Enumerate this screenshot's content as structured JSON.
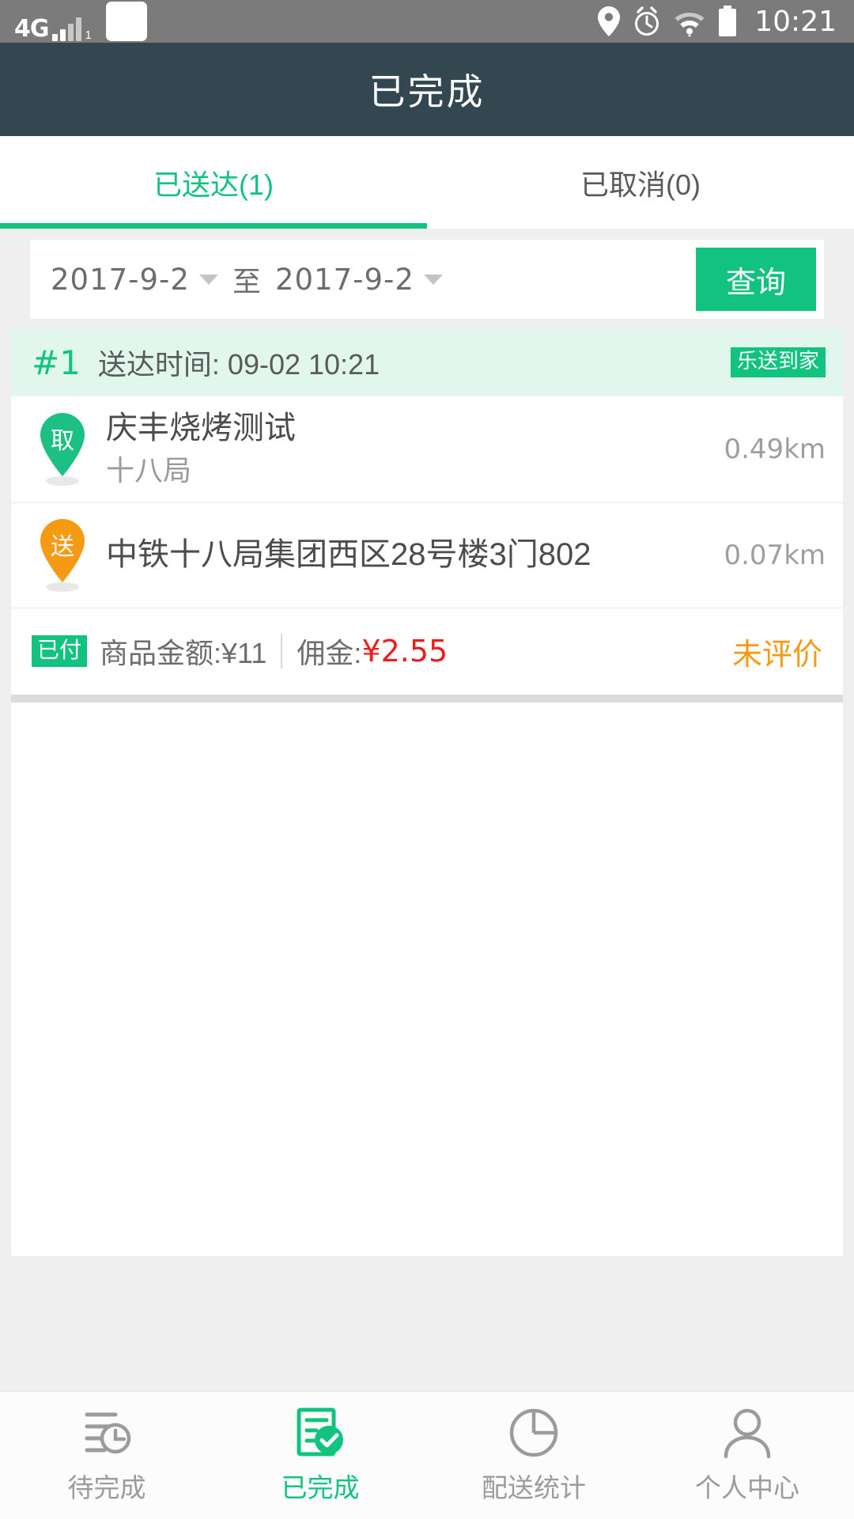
{
  "statusbar": {
    "network": "4G",
    "sim_sub": "1",
    "time": "10:21",
    "icons": [
      "location-icon",
      "alarm-icon",
      "wifi-icon",
      "battery-icon"
    ]
  },
  "header": {
    "title": "已完成"
  },
  "tabs": [
    {
      "label": "已送达(1)",
      "active": true
    },
    {
      "label": "已取消(0)",
      "active": false
    }
  ],
  "query": {
    "start_date": "2017-9-2",
    "to_label": "至",
    "end_date": "2017-9-2",
    "button_label": "查询"
  },
  "orders": [
    {
      "index": "#1",
      "delivered_time": "送达时间: 09-02 10:21",
      "source_badge": "乐送到家",
      "pickup": {
        "pin_letter": "取",
        "name": "庆丰烧烤测试",
        "sub": "十八局",
        "distance": "0.49km"
      },
      "dropoff": {
        "pin_letter": "送",
        "name": "中铁十八局集团西区28号楼3门802",
        "distance": "0.07km"
      },
      "payment": {
        "paid_badge": "已付",
        "goods_label": "商品金额:¥11",
        "commission_label": "佣金:",
        "commission_value": "¥2.55",
        "rating_status": "未评价"
      }
    }
  ],
  "bottom_nav": [
    {
      "label": "待完成",
      "icon": "list-clock-icon",
      "active": false
    },
    {
      "label": "已完成",
      "icon": "document-check-icon",
      "active": true
    },
    {
      "label": "配送统计",
      "icon": "pie-chart-icon",
      "active": false
    },
    {
      "label": "个人中心",
      "icon": "person-icon",
      "active": false
    }
  ],
  "colors": {
    "brand_green": "#12c380",
    "header_dark": "#32474f",
    "card_head_mint": "#e1f7ee",
    "orange_pin": "#f59a13",
    "red_commission": "#f01c1c",
    "page_bg": "#efefef"
  }
}
